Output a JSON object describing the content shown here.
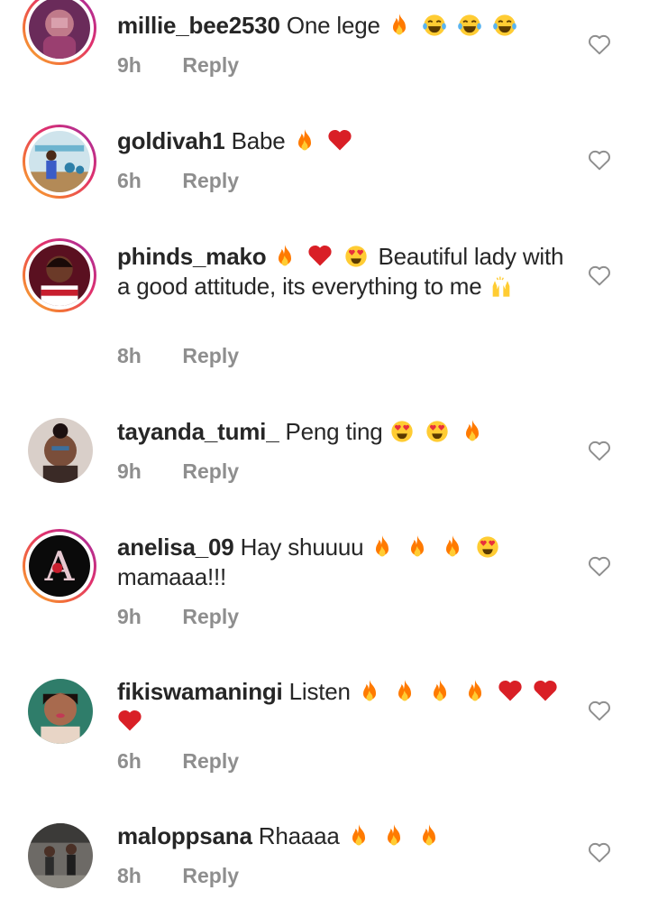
{
  "comments": [
    {
      "username": "millie_bee2530",
      "text_before": "One lege",
      "emojis_after": [
        "fire",
        "tears-of-joy",
        "tears-of-joy",
        "tears-of-joy"
      ],
      "text_after": "",
      "time": "9h",
      "reply": "Reply",
      "has_story_ring": true
    },
    {
      "username": "goldivah1",
      "text_before": "Babe",
      "emojis_after": [
        "fire",
        "red-heart"
      ],
      "text_after": "",
      "time": "6h",
      "reply": "Reply",
      "has_story_ring": true
    },
    {
      "username": "phinds_mako",
      "text_before": "",
      "emojis_after": [
        "fire",
        "red-heart",
        "heart-eyes"
      ],
      "text_after": "Beautiful lady with a good attitude, its everything to me",
      "trailing_emoji": "raising-hands",
      "time": "8h",
      "reply": "Reply",
      "has_story_ring": true
    },
    {
      "username": "tayanda_tumi_",
      "text_before": "Peng ting",
      "emojis_after": [
        "heart-eyes",
        "heart-eyes",
        "fire"
      ],
      "text_after": "",
      "time": "9h",
      "reply": "Reply",
      "has_story_ring": false
    },
    {
      "username": "anelisa_09",
      "text_before": "Hay shuuuu",
      "emojis_after": [
        "fire",
        "fire",
        "fire",
        "heart-eyes"
      ],
      "text_after": "mamaaa!!!",
      "time": "9h",
      "reply": "Reply",
      "has_story_ring": true
    },
    {
      "username": "fikiswamaningi",
      "text_before": "Listen",
      "emojis_after": [
        "fire",
        "fire",
        "fire",
        "fire",
        "red-heart",
        "red-heart",
        "red-heart"
      ],
      "text_after": "",
      "time": "6h",
      "reply": "Reply",
      "has_story_ring": false
    },
    {
      "username": "maloppsana",
      "text_before": "Rhaaaa",
      "emojis_after": [
        "fire",
        "fire",
        "fire"
      ],
      "text_after": "",
      "time": "8h",
      "reply": "Reply",
      "has_story_ring": false
    }
  ],
  "colors": {
    "text": "#262626",
    "meta": "#8e8e8e",
    "ring_start": "#f7b733",
    "ring_end": "#833ab4"
  },
  "icons": {
    "like": "heart-outline-icon"
  }
}
